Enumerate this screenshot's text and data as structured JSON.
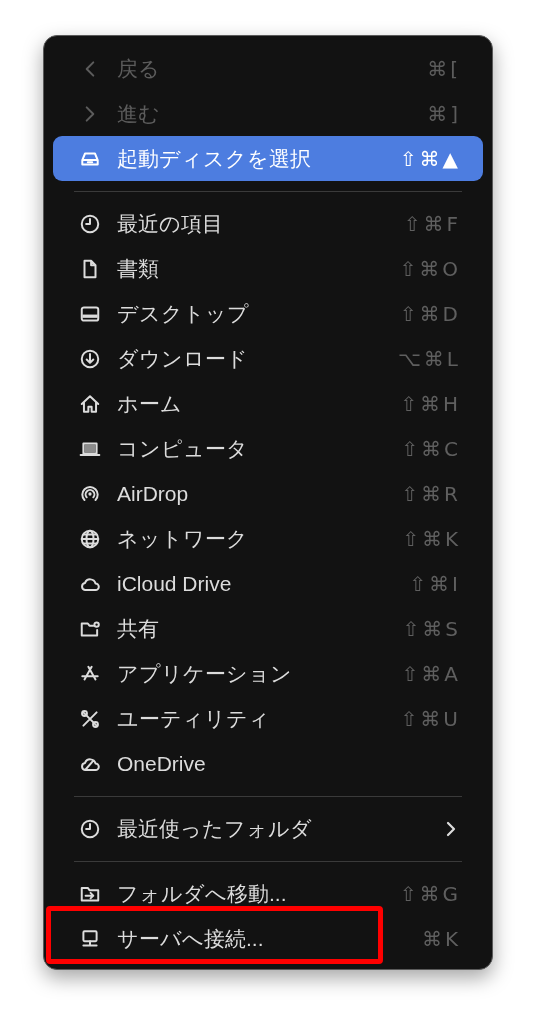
{
  "menu": {
    "sections": [
      {
        "items": [
          {
            "label": "戻る",
            "shortcut": "⌘[",
            "disabled": true,
            "selected": false,
            "submenu": false,
            "highlighted": false
          },
          {
            "label": "進む",
            "shortcut": "⌘]",
            "disabled": true,
            "selected": false,
            "submenu": false,
            "highlighted": false
          },
          {
            "label": "起動ディスクを選択",
            "shortcut": "⇧⌘▲",
            "disabled": false,
            "selected": true,
            "submenu": false,
            "highlighted": false
          }
        ]
      },
      {
        "items": [
          {
            "label": "最近の項目",
            "shortcut": "⇧⌘F",
            "disabled": false,
            "selected": false,
            "submenu": false,
            "highlighted": false
          },
          {
            "label": "書類",
            "shortcut": "⇧⌘O",
            "disabled": false,
            "selected": false,
            "submenu": false,
            "highlighted": false
          },
          {
            "label": "デスクトップ",
            "shortcut": "⇧⌘D",
            "disabled": false,
            "selected": false,
            "submenu": false,
            "highlighted": false
          },
          {
            "label": "ダウンロード",
            "shortcut": "⌥⌘L",
            "disabled": false,
            "selected": false,
            "submenu": false,
            "highlighted": false
          },
          {
            "label": "ホーム",
            "shortcut": "⇧⌘H",
            "disabled": false,
            "selected": false,
            "submenu": false,
            "highlighted": false
          },
          {
            "label": "コンピュータ",
            "shortcut": "⇧⌘C",
            "disabled": false,
            "selected": false,
            "submenu": false,
            "highlighted": false
          },
          {
            "label": "AirDrop",
            "shortcut": "⇧⌘R",
            "disabled": false,
            "selected": false,
            "submenu": false,
            "highlighted": false
          },
          {
            "label": "ネットワーク",
            "shortcut": "⇧⌘K",
            "disabled": false,
            "selected": false,
            "submenu": false,
            "highlighted": false
          },
          {
            "label": "iCloud Drive",
            "shortcut": "⇧⌘I",
            "disabled": false,
            "selected": false,
            "submenu": false,
            "highlighted": false
          },
          {
            "label": "共有",
            "shortcut": "⇧⌘S",
            "disabled": false,
            "selected": false,
            "submenu": false,
            "highlighted": false
          },
          {
            "label": "アプリケーション",
            "shortcut": "⇧⌘A",
            "disabled": false,
            "selected": false,
            "submenu": false,
            "highlighted": false
          },
          {
            "label": "ユーティリティ",
            "shortcut": "⇧⌘U",
            "disabled": false,
            "selected": false,
            "submenu": false,
            "highlighted": false
          },
          {
            "label": "OneDrive",
            "disabled": false,
            "selected": false,
            "submenu": false,
            "highlighted": false
          }
        ]
      },
      {
        "items": [
          {
            "label": "最近使ったフォルダ",
            "disabled": false,
            "selected": false,
            "submenu": true,
            "highlighted": false
          }
        ]
      },
      {
        "items": [
          {
            "label": "フォルダへ移動...",
            "shortcut": "⇧⌘G",
            "disabled": false,
            "selected": false,
            "submenu": false,
            "highlighted": false
          },
          {
            "label": "サーバへ接続...",
            "shortcut": "⌘K",
            "disabled": false,
            "selected": false,
            "submenu": false,
            "highlighted": true
          }
        ]
      }
    ]
  }
}
